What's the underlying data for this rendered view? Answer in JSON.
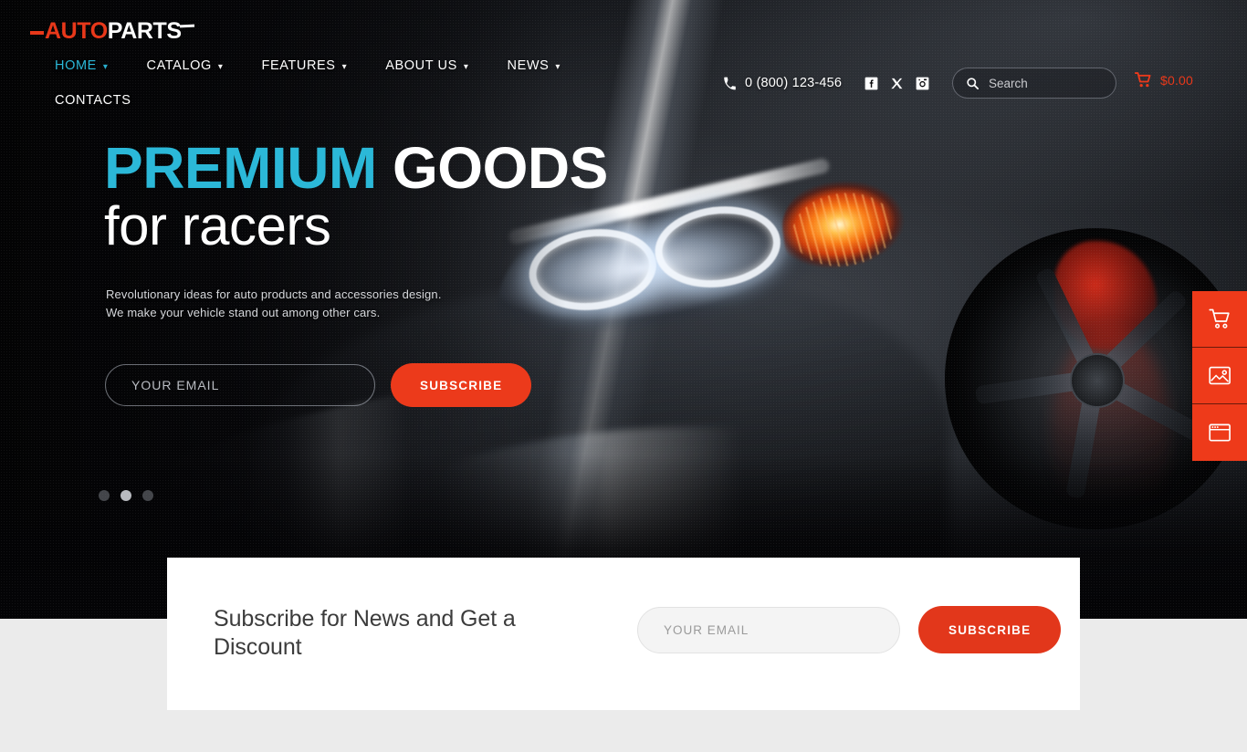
{
  "brand": {
    "name_first": "AUTO",
    "name_second": "PARTS",
    "accent_color": "#e8381a",
    "highlight_color": "#2bb8d8"
  },
  "header": {
    "nav": [
      {
        "label": "HOME",
        "has_caret": true,
        "active": true
      },
      {
        "label": "CATALOG",
        "has_caret": true,
        "active": false
      },
      {
        "label": "FEATURES",
        "has_caret": true,
        "active": false
      },
      {
        "label": "ABOUT US",
        "has_caret": true,
        "active": false
      },
      {
        "label": "NEWS",
        "has_caret": true,
        "active": false
      },
      {
        "label": "CONTACTS",
        "has_caret": false,
        "active": false
      }
    ],
    "phone": "0 (800) 123-456",
    "socials": [
      "facebook-icon",
      "x-twitter-icon",
      "instagram-icon"
    ],
    "search": {
      "value": "",
      "placeholder": "Search"
    },
    "cart": {
      "amount": "$0.00",
      "icon": "shopping-cart-icon"
    }
  },
  "hero": {
    "title_highlight": "PREMIUM",
    "title_rest": "GOODS",
    "subtitle": "for racers",
    "lead_line1": "Revolutionary ideas for auto products and accessories design.",
    "lead_line2": "We make your vehicle stand out among other cars.",
    "email": {
      "value": "",
      "placeholder": "YOUR EMAIL"
    },
    "subscribe_label": "SUBSCRIBE",
    "slider_dots": 3,
    "slider_active_index": 1
  },
  "side_buttons": [
    {
      "icon": "shopping-cart-icon",
      "name": "side-button-cart"
    },
    {
      "icon": "image-gallery-icon",
      "name": "side-button-gallery"
    },
    {
      "icon": "browser-window-icon",
      "name": "side-button-layout"
    }
  ],
  "subscribe_card": {
    "title": "Subscribe for News and Get a Discount",
    "email": {
      "value": "",
      "placeholder": "YOUR EMAIL"
    },
    "button_label": "SUBSCRIBE"
  }
}
